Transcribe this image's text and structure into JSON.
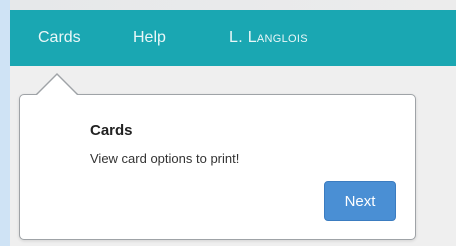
{
  "nav": {
    "items": [
      {
        "label": "Cards"
      },
      {
        "label": "Help"
      },
      {
        "label": "L. Langlois"
      }
    ]
  },
  "popover": {
    "title": "Cards",
    "text": "View card options to print!",
    "next_label": "Next"
  },
  "colors": {
    "topbar": "#1aa7b2",
    "button": "#4a8fd4",
    "popover_border": "#9fa3a7"
  }
}
